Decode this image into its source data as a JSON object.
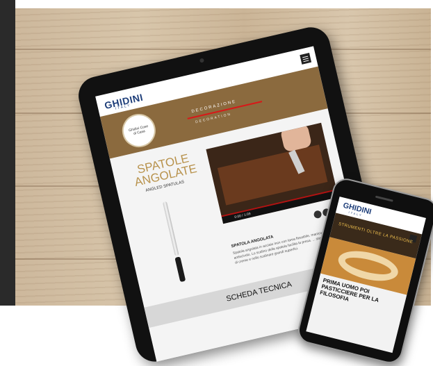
{
  "tablet": {
    "logo": "GHIDINI",
    "logo_sub": "ITALY",
    "banner_title": "DECORAZIONE",
    "banner_sub": "DECORATION",
    "product_title": "SPATOLE ANGOLATE",
    "product_sub": "ANGLED SPATULAS",
    "video_time": "0:00 / 1:09",
    "desc_title": "SPATOLA ANGOLATA",
    "desc_text": "Spatola angolata in acciaio inox con lama flessibile, manico e materiale antiscivolo. Lo scalino della spatola facilita la presa. ... stendere farciture di creme e nello scalinare grandi superfici.",
    "section": "SCHEDA TECNICA",
    "badge_text": "Ghidini Cose di Casa"
  },
  "phone": {
    "logo": "GHIDINI",
    "logo_sub": "ITALY",
    "banner": "STRUMENTI OLTRE LA PASSIONE",
    "caption": "PRIMA UOMO POI PASTICCIERE PER LA FILOSOFIA"
  },
  "colors": {
    "brand_blue": "#1f3f7a",
    "banner_brown": "#8b6a3e",
    "accent_gold": "#b8924c",
    "red_line": "#d81818"
  },
  "icons": {
    "menu": "hamburger-menu-icon",
    "share": "social-share-icons"
  }
}
